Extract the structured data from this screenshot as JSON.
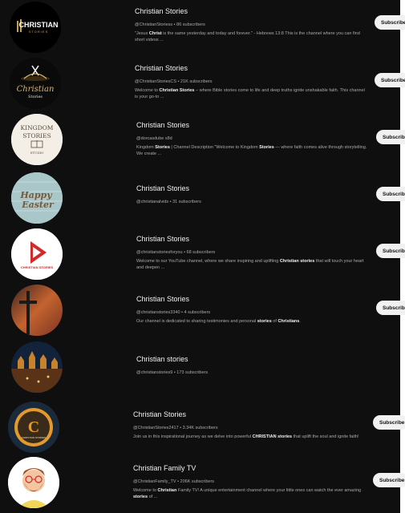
{
  "channels": [
    {
      "name": "Christian Stories",
      "handle_subs": "@ChristianStoriess • 86 subscribers",
      "desc": [
        "\"Jesus ",
        "Christ",
        " is the same yesterday and today and forever.\" - Hebrews 13:8 This is the channel where you can find short videos ..."
      ],
      "subscribe_label": "Subscribe",
      "avatar": {
        "text": "CHRISTIAN",
        "subtext": "STORIES",
        "bg": "#000000",
        "accent": "#c9a43b"
      }
    },
    {
      "name": "Christian Stories",
      "handle_subs": "@ChristianStoriesCS • 21K subscribers",
      "desc": [
        "Welcome to ",
        "Christian Stories",
        " – where Bible stories come to life and deep truths ignite unshakable faith. This channel is your go-to ..."
      ],
      "subscribe_label": "Subscribe",
      "avatar": {
        "text": "Christian",
        "subtext": "Stories",
        "bg": "#0a0a0a",
        "accent": "#d9b56a"
      }
    },
    {
      "name": "Christian Stories",
      "handle_subs": "@dorcasdube x8d",
      "desc": [
        "Kingdom ",
        "Stories",
        " | Channel Description \"Welcome to Kingdom ",
        "Stories",
        " — where faith comes alive through storytelling. We create ..."
      ],
      "subscribe_label": "Subscribe",
      "avatar": {
        "text": "KINGDOM",
        "subtext": "STORIES",
        "extra": "STUDIO",
        "bg": "#f3efe6",
        "accent": "#5a4a3a"
      }
    },
    {
      "name": "Christian Stories",
      "handle_subs": "@christianalvids • 31 subscribers",
      "desc": [],
      "subscribe_label": "Subscribe",
      "avatar": {
        "text": "Happy",
        "subtext": "Easter",
        "bg": "#a9c6c9",
        "accent": "#7a5a3a"
      }
    },
    {
      "name": "Christian Stories",
      "handle_subs": "@christianstoriesforyou • 68 subscribers",
      "desc": [
        "Welcome to our YouTube channel, where we share inspiring and uplifting ",
        "Christian stories",
        " that will touch your heart and deepen ..."
      ],
      "subscribe_label": "Subscribe",
      "avatar": {
        "text": "CHRISTIAN STORIES",
        "bg": "#ffffff",
        "accent": "#d22a2a"
      }
    },
    {
      "name": "Christian Stories",
      "handle_subs": "@christianstories3340 • 4 subscribers",
      "desc": [
        "Our channel is dedicated to sharing testimonies and personal ",
        "stories",
        " of ",
        "Christians",
        "."
      ],
      "subscribe_label": "Subscribe",
      "avatar": {
        "bg": "#b4552e",
        "accent": "#1a1a1a"
      }
    },
    {
      "name": "Christian stories",
      "handle_subs": "@christianstories9 • 173 subscribers",
      "desc": [],
      "subscribe_label": "Subscribe",
      "avatar": {
        "bg": "#12223a",
        "accent": "#c8822e"
      }
    },
    {
      "name": "Christian Stories",
      "handle_subs": "@ChristianStories2417 • 3.34K subscribers",
      "desc": [
        "Join us in this inspirational journey as we delve into powerful ",
        "CHRISTIAN stories",
        " that uplift the soul and ignite faith!"
      ],
      "subscribe_label": "Subscribe",
      "avatar": {
        "text": "C",
        "subtext": "CHRISTIAN STORIES",
        "bg": "#1b2a3a",
        "accent": "#e39a2c"
      }
    },
    {
      "name": "Christian Family TV",
      "handle_subs": "@ChristianFamily_TV • 206K subscribers",
      "desc": [
        "Welcome to ",
        "Christian",
        " Family TV! A unique entertainment channel where your little ones can watch the ever amazing ",
        "stories",
        " of ..."
      ],
      "subscribe_label": "Subscribe",
      "avatar": {
        "bg": "#ffffff",
        "accent": "#a0522d"
      }
    }
  ]
}
